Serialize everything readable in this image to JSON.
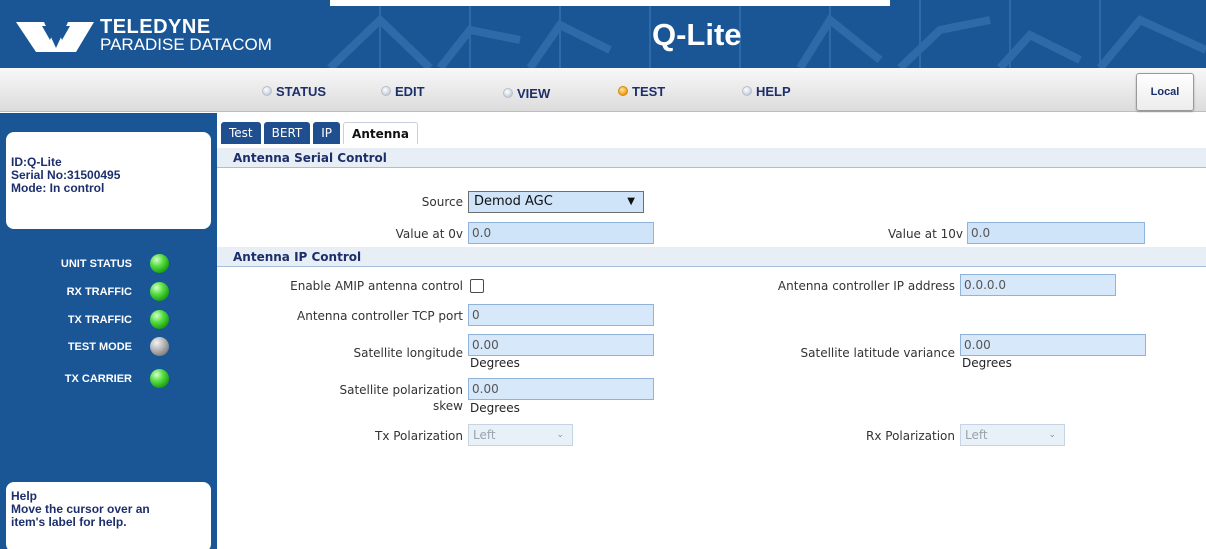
{
  "banner": {
    "brand_name": "TELEDYNE",
    "brand_sub": "PARADISE DATACOM",
    "app_title": "Q-Lite",
    "colors": {
      "banner_bg": "#1a5696",
      "text": "#ffffff"
    }
  },
  "nav": {
    "items": [
      {
        "label": "STATUS",
        "active": false
      },
      {
        "label": "EDIT",
        "active": false
      },
      {
        "label": "VIEW",
        "active": false
      },
      {
        "label": "TEST",
        "active": true
      },
      {
        "label": "HELP",
        "active": false
      }
    ],
    "local_button": "Local",
    "active_color": "#f3a21b"
  },
  "sidebar": {
    "id_line": "ID:Q-Lite",
    "serial_line": "Serial No:31500495",
    "mode_line": "Mode: In control",
    "leds": [
      {
        "label": "UNIT STATUS",
        "state": "green"
      },
      {
        "label": "RX TRAFFIC",
        "state": "green"
      },
      {
        "label": "TX TRAFFIC",
        "state": "green"
      },
      {
        "label": "TEST MODE",
        "state": "gray"
      },
      {
        "label": "TX CARRIER",
        "state": "green"
      }
    ],
    "help_title": "Help",
    "help_text_1": "Move the cursor over an",
    "help_text_2": "item's label for help."
  },
  "tabs": [
    {
      "label": "Test",
      "active": false
    },
    {
      "label": "BERT",
      "active": false
    },
    {
      "label": "IP",
      "active": false
    },
    {
      "label": "Antenna",
      "active": true
    }
  ],
  "serial_control": {
    "header": "Antenna Serial Control",
    "source_label": "Source",
    "source_value": "Demod AGC",
    "value0_label": "Value at 0v",
    "value0": "0.0",
    "value10_label": "Value at 10v",
    "value10": "0.0"
  },
  "ip_control": {
    "header": "Antenna IP Control",
    "enable_label": "Enable AMIP antenna control",
    "enable_checked": false,
    "ip_label": "Antenna controller IP address",
    "ip_value": "0.0.0.0",
    "tcp_label": "Antenna controller TCP port",
    "tcp_value": "0",
    "lon_label": "Satellite longitude",
    "lon_value": "0.00",
    "lon_unit": "Degrees",
    "lat_label": "Satellite latitude variance",
    "lat_value": "0.00",
    "lat_unit": "Degrees",
    "skew_label_1": "Satellite polarization",
    "skew_label_2": "skew",
    "skew_value": "0.00",
    "skew_unit": "Degrees",
    "tx_pol_label": "Tx Polarization",
    "tx_pol_value": "Left",
    "rx_pol_label": "Rx Polarization",
    "rx_pol_value": "Left"
  }
}
